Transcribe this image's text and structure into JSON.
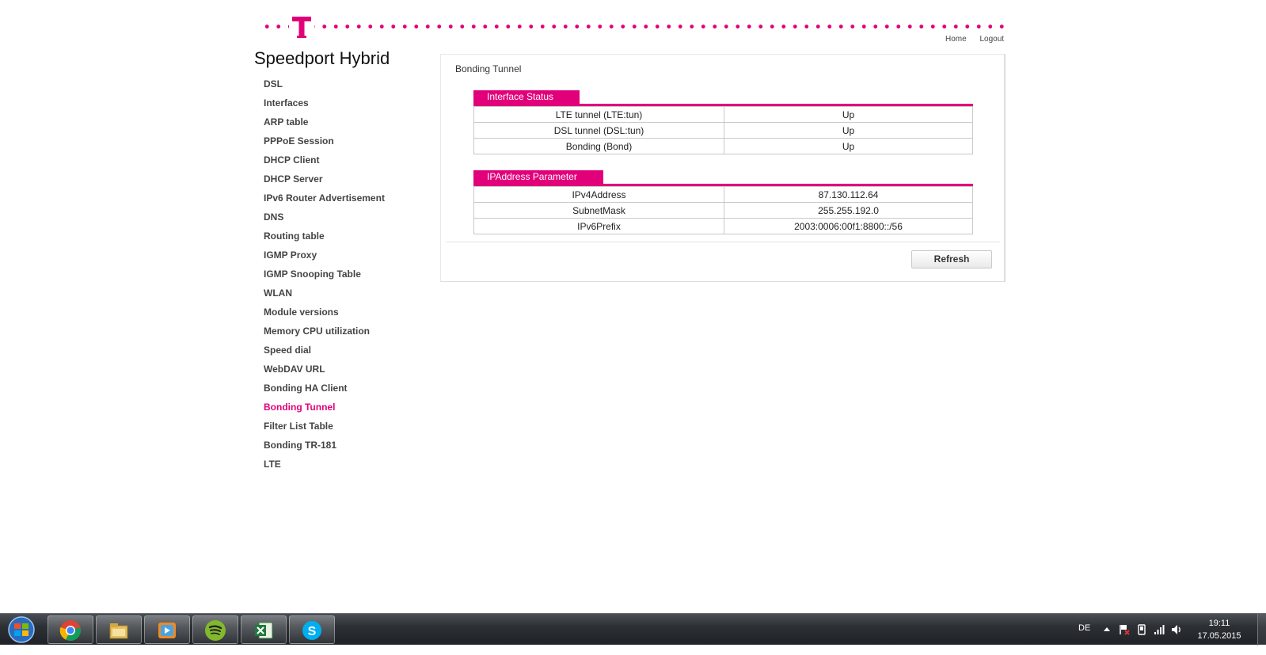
{
  "header": {
    "brand": "Speedport Hybrid",
    "links": {
      "home": "Home",
      "logout": "Logout"
    }
  },
  "sidebar": {
    "items": [
      {
        "label": "DSL"
      },
      {
        "label": "Interfaces"
      },
      {
        "label": "ARP table"
      },
      {
        "label": "PPPoE Session"
      },
      {
        "label": "DHCP Client"
      },
      {
        "label": "DHCP Server"
      },
      {
        "label": "IPv6 Router Advertisement"
      },
      {
        "label": "DNS"
      },
      {
        "label": "Routing table"
      },
      {
        "label": "IGMP Proxy"
      },
      {
        "label": "IGMP Snooping Table"
      },
      {
        "label": "WLAN"
      },
      {
        "label": "Module versions"
      },
      {
        "label": "Memory CPU utilization"
      },
      {
        "label": "Speed dial"
      },
      {
        "label": "WebDAV URL"
      },
      {
        "label": "Bonding HA Client"
      },
      {
        "label": "Bonding Tunnel",
        "active": true
      },
      {
        "label": "Filter List Table"
      },
      {
        "label": "Bonding TR-181"
      },
      {
        "label": "LTE"
      }
    ]
  },
  "main": {
    "title": "Bonding Tunnel",
    "interface_status": {
      "heading": "Interface Status",
      "rows": [
        {
          "key": "LTE tunnel (LTE:tun)",
          "value": "Up"
        },
        {
          "key": "DSL tunnel (DSL:tun)",
          "value": "Up"
        },
        {
          "key": "Bonding (Bond)",
          "value": "Up"
        }
      ]
    },
    "ip_parameter": {
      "heading": "IPAddress Parameter",
      "rows": [
        {
          "key": "IPv4Address",
          "value": "87.130.112.64"
        },
        {
          "key": "SubnetMask",
          "value": "255.255.192.0"
        },
        {
          "key": "IPv6Prefix",
          "value": "2003:0006:00f1:8800::/56"
        }
      ]
    },
    "refresh_label": "Refresh"
  },
  "taskbar": {
    "apps": [
      "chrome-icon",
      "explorer-icon",
      "media-player-icon",
      "spotify-icon",
      "excel-icon",
      "skype-icon"
    ],
    "language": "DE",
    "time": "19:11",
    "date": "17.05.2015"
  },
  "colors": {
    "accent": "#e2007a"
  }
}
